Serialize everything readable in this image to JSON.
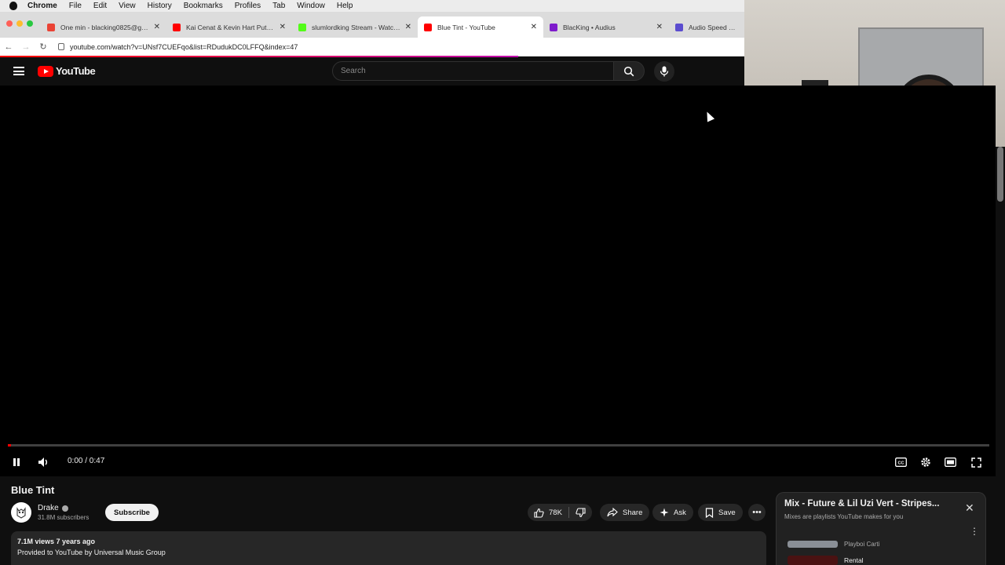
{
  "menubar": {
    "app": "Chrome",
    "items": [
      "File",
      "Edit",
      "View",
      "History",
      "Bookmarks",
      "Profiles",
      "Tab",
      "Window",
      "Help"
    ]
  },
  "tabs": [
    {
      "title": "One min - blacking0825@gma",
      "favicon_color": "#ea4335"
    },
    {
      "title": "Kai Cenat & Kevin Hart Put Dru",
      "favicon_color": "#ff0000"
    },
    {
      "title": "slumlordking Stream - Watch L",
      "favicon_color": "#53fc18"
    },
    {
      "title": "Blue Tint - YouTube",
      "favicon_color": "#ff0000",
      "active": true
    },
    {
      "title": "BlacKing • Audius",
      "favicon_color": "#7e1bcc"
    },
    {
      "title": "Audio Speed and Pi",
      "favicon_color": "#5b4ccf"
    }
  ],
  "address": {
    "url": "youtube.com/watch?v=UNsf7CUEFqo&list=RDudukDC0LFFQ&index=47"
  },
  "youtube": {
    "logo_text": "YouTube",
    "search_placeholder": "Search"
  },
  "player": {
    "current_time": "0:00",
    "duration": "0:47",
    "timecode": "0:00 / 0:47",
    "progress_fraction": 0.003
  },
  "video": {
    "title": "Blue Tint",
    "channel": "Drake",
    "subscribers": "31.8M subscribers",
    "subscribe_label": "Subscribe",
    "likes": "78K",
    "share_label": "Share",
    "ask_label": "Ask",
    "save_label": "Save",
    "meta": "7.1M views  7 years ago",
    "provided": "Provided to YouTube by Universal Music Group"
  },
  "mix": {
    "title": "Mix - Future & Lil Uzi Vert - Stripes...",
    "subtitle": "Mixes are playlists YouTube makes for you",
    "items": [
      {
        "name": "",
        "artist": "Playboi Carti"
      },
      {
        "name": "Rental",
        "artist": ""
      }
    ]
  },
  "colors": {
    "youtube_red": "#ff0000",
    "background": "#0f0f0f",
    "pill": "#272727"
  }
}
